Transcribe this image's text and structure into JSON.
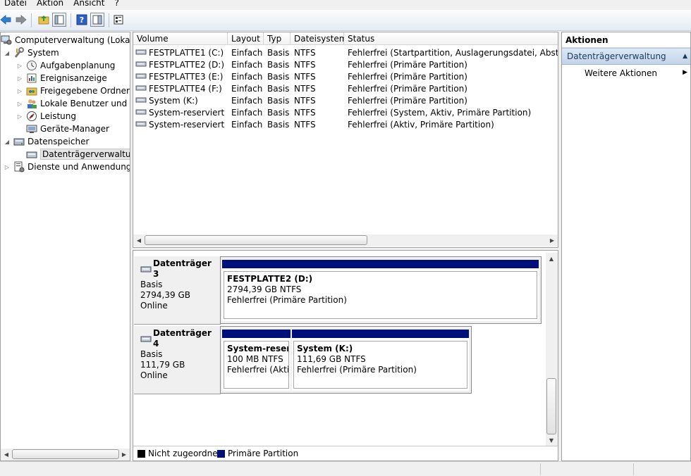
{
  "menu": [
    "Datei",
    "Aktion",
    "Ansicht",
    "?"
  ],
  "toolbar": {
    "icons": [
      "back-arrow-icon",
      "forward-arrow-icon",
      "up-folder-icon",
      "show-hide-console-tree-icon",
      "help-icon",
      "show-hide-action-pane-icon",
      "properties-icon"
    ]
  },
  "tree": {
    "root": "Computerverwaltung (Lokal)",
    "system": "System",
    "aufgabenplanung": "Aufgabenplanung",
    "ereignisanzeige": "Ereignisanzeige",
    "freigegebene_ordner": "Freigegebene Ordner",
    "lokale_benutzer": "Lokale Benutzer und Gr",
    "leistung": "Leistung",
    "geraete_manager": "Geräte-Manager",
    "datenspeicher": "Datenspeicher",
    "datentraegerverwaltung": "Datenträgerverwaltung",
    "dienste": "Dienste und Anwendungen"
  },
  "volume_list": {
    "columns": [
      "Volume",
      "Layout",
      "Typ",
      "Dateisystem",
      "Status"
    ],
    "rows": [
      [
        "FESTPLATTE1 (C:)",
        "Einfach",
        "Basis",
        "NTFS",
        "Fehlerfrei (Startpartition, Auslagerungsdatei, Absturzabbi"
      ],
      [
        "FESTPLATTE2 (D:)",
        "Einfach",
        "Basis",
        "NTFS",
        "Fehlerfrei (Primäre Partition)"
      ],
      [
        "FESTPLATTE3 (E:)",
        "Einfach",
        "Basis",
        "NTFS",
        "Fehlerfrei (Primäre Partition)"
      ],
      [
        "FESTPLATTE4 (F:)",
        "Einfach",
        "Basis",
        "NTFS",
        "Fehlerfrei (Primäre Partition)"
      ],
      [
        "System (K:)",
        "Einfach",
        "Basis",
        "NTFS",
        "Fehlerfrei (Primäre Partition)"
      ],
      [
        "System-reserviert",
        "Einfach",
        "Basis",
        "NTFS",
        "Fehlerfrei (System, Aktiv, Primäre Partition)"
      ],
      [
        "System-reserviert (J:)",
        "Einfach",
        "Basis",
        "NTFS",
        "Fehlerfrei (Aktiv, Primäre Partition)"
      ]
    ]
  },
  "disks": {
    "disk3": {
      "name": "Datenträger 3",
      "type": "Basis",
      "size": "2794,39 GB",
      "state": "Online",
      "partition": {
        "name": "FESTPLATTE2  (D:)",
        "size": "2794,39 GB NTFS",
        "status": "Fehlerfrei (Primäre Partition)"
      }
    },
    "disk4": {
      "name": "Datenträger 4",
      "type": "Basis",
      "size": "111,79 GB",
      "state": "Online",
      "partition1": {
        "name": "System-reserv",
        "size": "100 MB NTFS",
        "status": "Fehlerfrei (Aktiv"
      },
      "partition2": {
        "name": "System  (K:)",
        "size": "111,69 GB NTFS",
        "status": "Fehlerfrei (Primäre Partition)"
      }
    }
  },
  "legend": {
    "unallocated": "Nicht zugeordnet",
    "primary": "Primäre Partition",
    "unallocated_color": "#000000",
    "primary_color": "#00107a"
  },
  "actions": {
    "header": "Aktionen",
    "section": "Datenträgerverwaltung",
    "more": "Weitere Aktionen"
  }
}
